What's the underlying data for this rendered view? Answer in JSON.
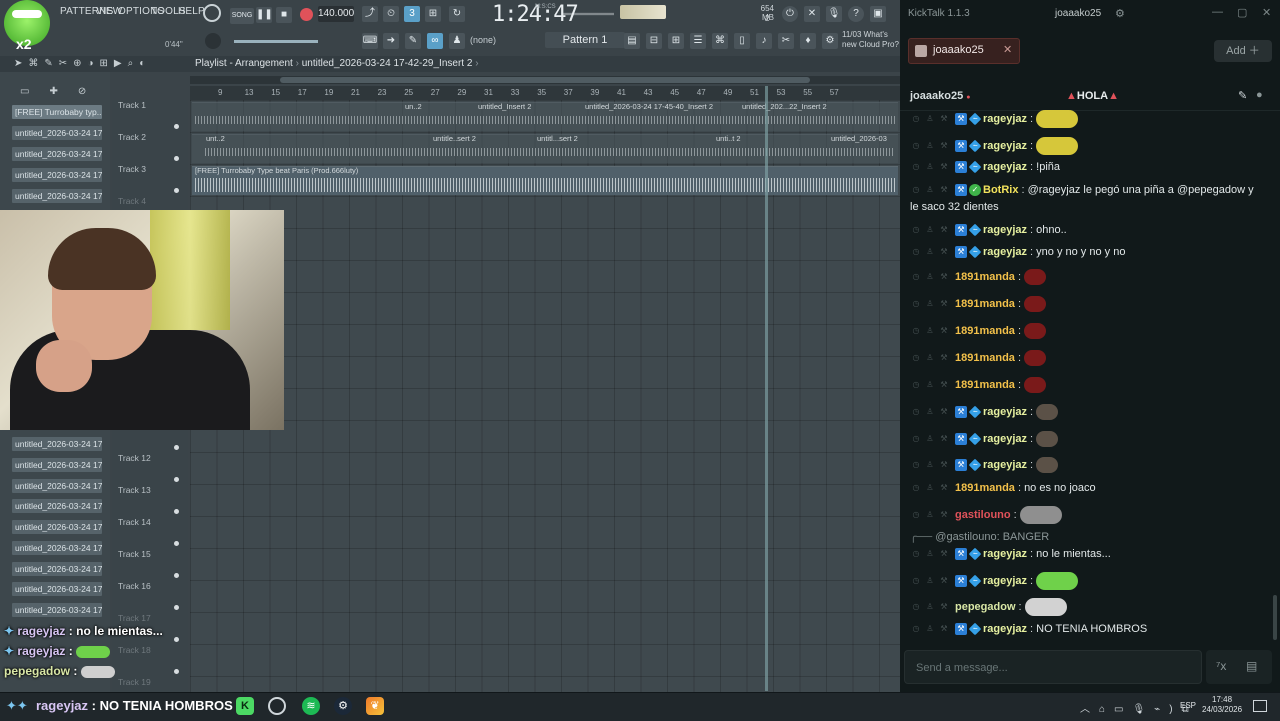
{
  "fl": {
    "menu": [
      "PATTERNS",
      "VIEW",
      "OPTIONS",
      "TOOLS",
      "HELP"
    ],
    "song_label": "SONG",
    "bpm": "140.000",
    "clock": "1:24:47",
    "clock_unit": "M:S:CS",
    "memory": "654 MB",
    "memory_sub": "2",
    "pattern": "Pattern 1",
    "none_selector": "(none)",
    "hint": "11/03  What's new  Cloud Pro?",
    "time_small": "0'44\"",
    "playlist_title": "Playlist - Arrangement",
    "playlist_file": "untitled_2026-03-24 17-42-29_Insert 2",
    "ruler_ticks": [
      "9",
      "13",
      "15",
      "17",
      "19",
      "21",
      "23",
      "25",
      "27",
      "29",
      "31",
      "33",
      "35",
      "37",
      "39",
      "41",
      "43",
      "45",
      "47",
      "49",
      "51",
      "53",
      "55",
      "57"
    ],
    "top_pattern": "[FREE] Turrobaby typ...",
    "patterns": [
      "untitled_2026-03-24 17-...",
      "untitled_2026-03-24 17-...",
      "untitled_2026-03-24 17-...",
      "untitled_2026-03-24 17-...",
      "untitled_2026-03-24 17-...",
      "untitled_2026-03-24 17-...",
      "untitled_2026-03-24 17-...",
      "untitled_2026-03-24 17-...",
      "untitled_2026-03-24 17-...",
      "untitled_2026-03-24 17-...",
      "untitled_2026-03-24 17-...",
      "untitled_2026-03-24 17-...",
      "untitled_2026-03-24 17-..."
    ],
    "tracks_top": [
      "Track 1",
      "Track 2",
      "Track 3",
      "Track 4"
    ],
    "tracks_bottom": [
      "Track 12",
      "Track 13",
      "Track 14",
      "Track 15",
      "Track 16",
      "Track 17",
      "Track 18",
      "Track 19"
    ],
    "clip_labels_track1": [
      "un..2",
      "untitled_Insert 2",
      "untitled_2026-03-24 17-45-40_Insert 2",
      "untitled_202...22_Insert 2"
    ],
    "clip_labels_track2": [
      "unt..2",
      "untitle..sert 2",
      "untitl...sert 2",
      "unti..t 2",
      "untitled_2026-03"
    ],
    "clip_label_track3": "[FREE] Turrobaby Type beat Paris (Prod.666luty)"
  },
  "overlay_chat": [
    {
      "user": "rageyjaz",
      "text": "no le mientas..."
    },
    {
      "user": "rageyjaz",
      "text": ""
    },
    {
      "user": "pepegadow",
      "text": ""
    }
  ],
  "taskbar": {
    "ticker_user": "rageyjaz",
    "ticker_text": "NO TENIA HOMBROS",
    "lang": "ESP",
    "time": "17:48",
    "date": "24/03/2026"
  },
  "kicktalk": {
    "app_title": "KickTalk 1.1.3",
    "user": "joaaako25",
    "tab_name": "joaaako25",
    "add_label": "Add",
    "channel": "joaaako25",
    "pinned": "HOLA",
    "input_placeholder": "Send a message...",
    "messages": [
      {
        "user": "rageyjaz",
        "color": "#e6f0a0",
        "badges": "mod",
        "text": "",
        "emote": "#d6c73a"
      },
      {
        "user": "rageyjaz",
        "color": "#e6f0a0",
        "badges": "mod",
        "text": "",
        "emote": "#d6c73a"
      },
      {
        "user": "rageyjaz",
        "color": "#e6f0a0",
        "badges": "mod",
        "text": "!piña"
      },
      {
        "user": "BotRix",
        "color": "#f2e25c",
        "badges": "bot",
        "text": "@rageyjaz le pegó una piña a @pepegadow y",
        "cont": "le saco 32 dientes"
      },
      {
        "user": "rageyjaz",
        "color": "#e6f0a0",
        "badges": "mod",
        "text": "ohno.."
      },
      {
        "user": "rageyjaz",
        "color": "#e6f0a0",
        "badges": "mod",
        "text": "yno y no y no y no"
      },
      {
        "user": "1891manda",
        "color": "#f2c04a",
        "badges": "none",
        "text": "",
        "emote": "#7a1a1a",
        "emote_sm": true
      },
      {
        "user": "1891manda",
        "color": "#f2c04a",
        "badges": "none",
        "text": "",
        "emote": "#7a1a1a",
        "emote_sm": true
      },
      {
        "user": "1891manda",
        "color": "#f2c04a",
        "badges": "none",
        "text": "",
        "emote": "#7a1a1a",
        "emote_sm": true
      },
      {
        "user": "1891manda",
        "color": "#f2c04a",
        "badges": "none",
        "text": "",
        "emote": "#7a1a1a",
        "emote_sm": true
      },
      {
        "user": "1891manda",
        "color": "#f2c04a",
        "badges": "none",
        "text": "",
        "emote": "#7a1a1a",
        "emote_sm": true
      },
      {
        "user": "rageyjaz",
        "color": "#e6f0a0",
        "badges": "mod",
        "text": "",
        "emote": "#5b5147",
        "emote_sm": true
      },
      {
        "user": "rageyjaz",
        "color": "#e6f0a0",
        "badges": "mod",
        "text": "",
        "emote": "#5b5147",
        "emote_sm": true
      },
      {
        "user": "rageyjaz",
        "color": "#e6f0a0",
        "badges": "mod",
        "text": "",
        "emote": "#5b5147",
        "emote_sm": true
      },
      {
        "user": "1891manda",
        "color": "#f2c04a",
        "badges": "none",
        "text": "no es no joaco"
      },
      {
        "user": "gastilouno",
        "color": "#e0525a",
        "badges": "none",
        "text": "",
        "emote": "#8f8f8f"
      },
      {
        "reply": "@gastilouno: BANGER"
      },
      {
        "user": "rageyjaz",
        "color": "#e6f0a0",
        "badges": "mod",
        "text": "no le mientas..."
      },
      {
        "user": "rageyjaz",
        "color": "#e6f0a0",
        "badges": "mod",
        "text": "",
        "emote": "#6fd14a"
      },
      {
        "user": "pepegadow",
        "color": "#d9e7a6",
        "badges": "none",
        "text": "",
        "emote": "#d2d2d2"
      },
      {
        "user": "rageyjaz",
        "color": "#e6f0a0",
        "badges": "mod",
        "text": "NO TENIA HOMBROS"
      }
    ]
  }
}
